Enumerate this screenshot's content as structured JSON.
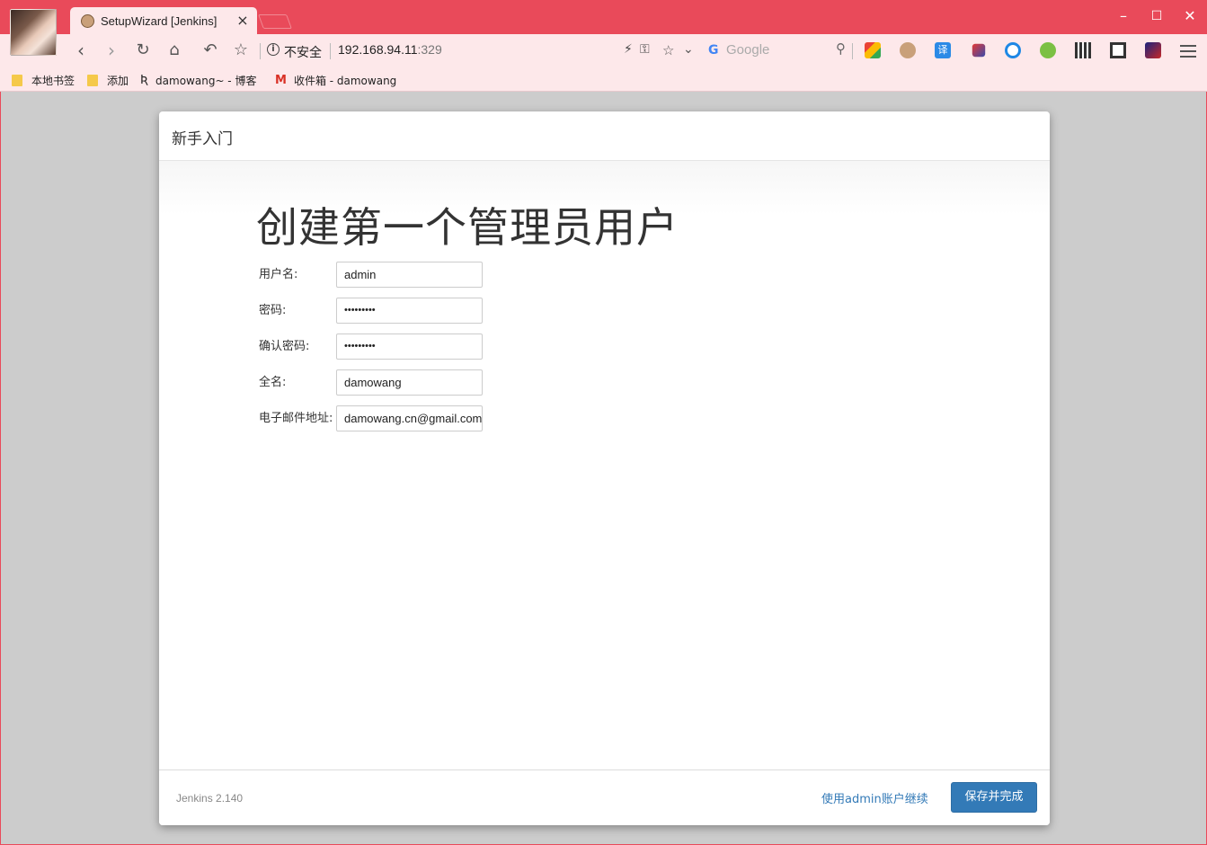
{
  "browser": {
    "tab_title": "SetupWizard [Jenkins]",
    "tab_close": "×",
    "security_label": "不安全",
    "url_host": "192.168.94.11",
    "url_port": ":329",
    "search_placeholder": "Google",
    "bookmarks": [
      {
        "label": "本地书签",
        "icon": "folder-icon"
      },
      {
        "label": "添加",
        "icon": "folder-icon"
      },
      {
        "label": "damowang~ - 博客",
        "icon": "blog-icon"
      },
      {
        "label": "收件箱 - damowang",
        "icon": "gmail-icon"
      }
    ]
  },
  "dialog": {
    "header_title": "新手入门",
    "heading": "创建第一个管理员用户",
    "fields": [
      {
        "label": "用户名:",
        "value": "admin"
      },
      {
        "label": "密码:",
        "value": "•••••••••"
      },
      {
        "label": "确认密码:",
        "value": "•••••••••"
      },
      {
        "label": "全名:",
        "value": "damowang"
      },
      {
        "label": "电子邮件地址:",
        "value": "damowang.cn@gmail.com"
      }
    ],
    "version": "Jenkins 2.140",
    "continue_link": "使用admin账户继续",
    "save_button": "保存并完成"
  },
  "colors": {
    "browser_accent": "#e94a5a",
    "primary_button": "#337ab7",
    "page_background": "#cccccc"
  }
}
